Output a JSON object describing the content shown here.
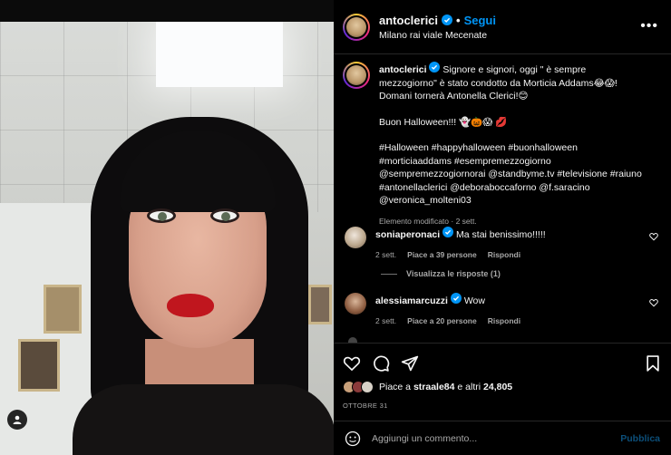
{
  "post": {
    "username": "antoclerici",
    "follow_label": "Segui",
    "dot": "•",
    "location": "Milano rai viale Mecenate",
    "more": "•••"
  },
  "caption": {
    "username": "antoclerici",
    "line1": "Signore e signori, oggi \" è sempre",
    "line2": "mezzogiorno\" è stato condotto da Morticia Addams😂😱!",
    "line3": "Domani tornerà Antonella Clerici!😊",
    "line4": "Buon Halloween!!! 👻🎃😱 💋",
    "line5": "#Halloween #happyhalloween #buonhalloween",
    "line6": "#morticiaaddams #esempremezzogiorno",
    "line7": "@sempremezzogiornorai @standbyme.tv #televisione #raiuno",
    "line8": "#antonellaclerici @deboraboccaforno @f.saracino",
    "line9": "@veronica_molteni03",
    "meta": "Elemento modificato · 2 sett."
  },
  "comments": [
    {
      "username": "soniaperonaci",
      "text": "Ma stai benissimo!!!!!",
      "age": "2 sett.",
      "likes": "Piace a 39 persone",
      "reply": "Rispondi"
    },
    {
      "username": "alessiamarcuzzi",
      "text": "Wow",
      "age": "2 sett.",
      "likes": "Piace a 20 persone",
      "reply": "Rispondi"
    }
  ],
  "replies_label": "Visualizza le risposte (1)",
  "likes": {
    "prefix": "Piace a ",
    "user": "straale84",
    "middle": " e altri ",
    "count": "24,805"
  },
  "date": "OTTOBRE 31",
  "composer": {
    "placeholder": "Aggiungi un commento...",
    "publish": "Pubblica"
  },
  "colors": {
    "accent": "#0095f6",
    "publish_disabled": "#0c4f7a",
    "muted": "#a8a8a8"
  },
  "icons": [
    "heart-icon",
    "comment-icon",
    "share-icon",
    "bookmark-icon",
    "emoji-icon",
    "user-tag-icon"
  ]
}
